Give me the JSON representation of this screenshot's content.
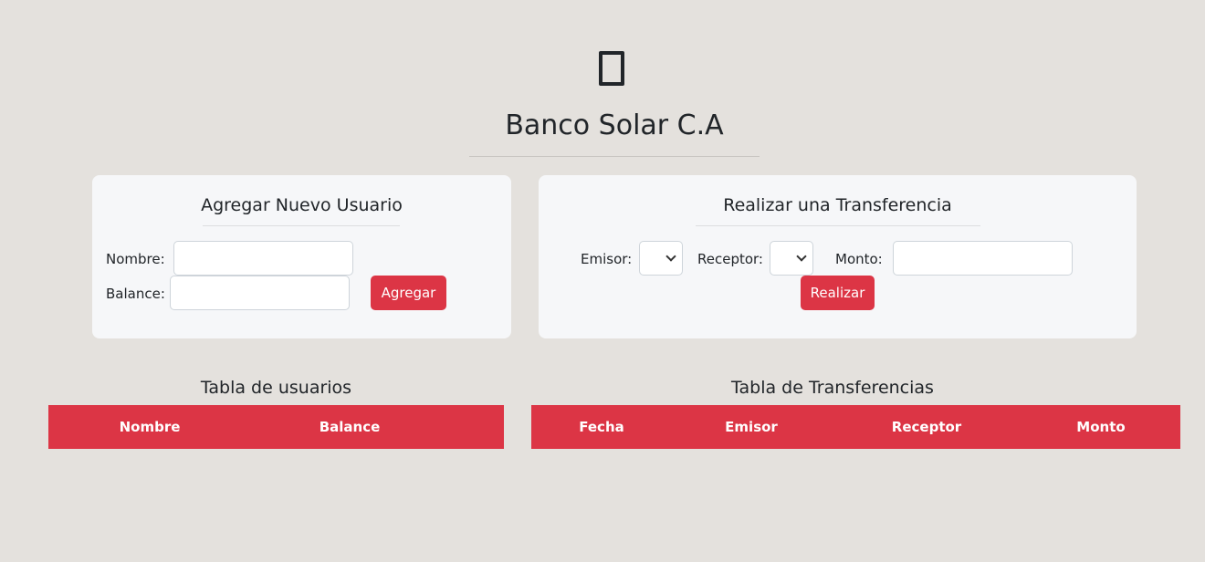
{
  "header": {
    "logo_icon": "bank-icon",
    "title": "Banco Solar C.A"
  },
  "add_user": {
    "title": "Agregar Nuevo Usuario",
    "name_label": "Nombre:",
    "name_value": "",
    "balance_label": "Balance:",
    "balance_value": "",
    "submit_label": "Agregar"
  },
  "transfer": {
    "title": "Realizar una Transferencia",
    "sender_label": "Emisor:",
    "sender_value": "",
    "receiver_label": "Receptor:",
    "receiver_value": "",
    "amount_label": "Monto:",
    "amount_value": "",
    "submit_label": "Realizar"
  },
  "users_table": {
    "title": "Tabla de usuarios",
    "columns": [
      "Nombre",
      "Balance"
    ],
    "rows": []
  },
  "transfers_table": {
    "title": "Tabla de Transferencias",
    "columns": [
      "Fecha",
      "Emisor",
      "Receptor",
      "Monto"
    ],
    "rows": []
  },
  "colors": {
    "accent": "#dc3545",
    "background": "#e4e1dd",
    "card": "#f6f7f9"
  }
}
